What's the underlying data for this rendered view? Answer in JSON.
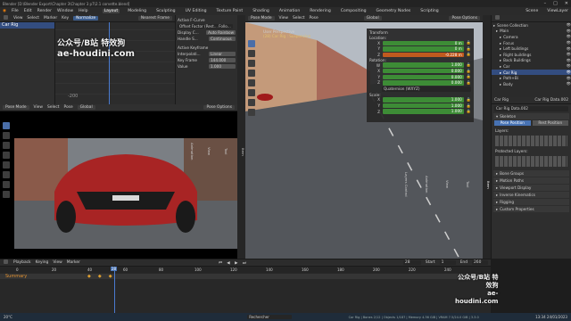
{
  "window": {
    "title": "Blender [D:\\Blender Export\\Chapter 3\\Chapter 3 p7\\2.1 corvette.blend]",
    "controls": [
      "–",
      "□",
      "✕"
    ]
  },
  "menus": [
    "File",
    "Edit",
    "Render",
    "Window",
    "Help"
  ],
  "workspaces": [
    "Layout",
    "Modeling",
    "Sculpting",
    "UV Editing",
    "Texture Paint",
    "Shading",
    "Animation",
    "Rendering",
    "Compositing",
    "Geometry Nodes",
    "Scripting"
  ],
  "active_workspace": "Layout",
  "scene": {
    "name": "Scene",
    "view_layer": "ViewLayer"
  },
  "graph": {
    "header": [
      "View",
      "Select",
      "Marker",
      "Key"
    ],
    "normalize": "Normalize",
    "pivot": "Nearest Frame",
    "label_200": "-200"
  },
  "fcurve": {
    "title": "Active F-Curve",
    "name": "Offset Factor (Rest... Follo...",
    "display_color_label": "Display C...",
    "display_color": "Auto Rainbow",
    "handle_label": "Handle S...",
    "handle": "Continuous",
    "kf_title": "Active Keyframe",
    "interp_label": "Interpolati...",
    "interp": "Linear",
    "keyframe_label": "Key Frame",
    "keyframe": "144.000",
    "value_label": "Value",
    "value": "1.000"
  },
  "left_viewport": {
    "mode": "Pose Mode",
    "menus": [
      "View",
      "Select",
      "Pose"
    ],
    "orient": "Global",
    "options": "Pose Options"
  },
  "viewport": {
    "mode": "Pose Mode",
    "menus": [
      "View",
      "Select",
      "Pose"
    ],
    "orient": "Global",
    "options": "Pose Options",
    "persp": "User Perspective",
    "sub": "(28) Car Rig : Suspension"
  },
  "side_tabs_left": [
    "Item",
    "Tool",
    "View",
    "Animation"
  ],
  "side_tabs_right": [
    "Item",
    "Tool",
    "View",
    "Animation",
    "Layers Control",
    "Tool"
  ],
  "transform": {
    "title": "Transform",
    "location": "Location:",
    "loc": [
      {
        "axis": "X",
        "v": "0 m",
        "c": "g"
      },
      {
        "axis": "Y",
        "v": "0 m",
        "c": "g"
      },
      {
        "axis": "Z",
        "v": "-0.228 m",
        "c": "o"
      }
    ],
    "rotation": "Rotation:",
    "rot": [
      {
        "axis": "W",
        "v": "1.000",
        "c": "g"
      },
      {
        "axis": "X",
        "v": "0.000",
        "c": "g"
      },
      {
        "axis": "Y",
        "v": "0.000",
        "c": "g"
      },
      {
        "axis": "Z",
        "v": "0.000",
        "c": "g"
      }
    ],
    "rot_mode": "Quaternion (WXYZ)",
    "scale": "Scale:",
    "scl": [
      {
        "axis": "X",
        "v": "1.000",
        "c": "g"
      },
      {
        "axis": "Y",
        "v": "1.000",
        "c": "g"
      },
      {
        "axis": "Z",
        "v": "1.000",
        "c": "g"
      }
    ]
  },
  "outliner": {
    "items": [
      "Scene Collection",
      "Main",
      "Camera",
      "Focus",
      "Left buildings",
      "Right buildings",
      "Back Buildings",
      "Car",
      "Car Rig",
      "Path+Bi",
      "Body"
    ]
  },
  "properties": {
    "object": "Car Rig",
    "data": "Car Rig Data.002",
    "data_field": "Car Rig Data.002",
    "skeleton": "Skeleton",
    "pose_position": "Pose Position",
    "rest_position": "Rest Position",
    "layers": "Layers:",
    "protected": "Protected Layers:",
    "sections": [
      "Bone Groups",
      "Motion Paths",
      "Viewport Display",
      "Inverse Kinematics",
      "Rigging",
      "Custom Properties"
    ]
  },
  "timeline": {
    "menus": [
      "Playback",
      "Keying",
      "View",
      "Marker"
    ],
    "frame": "28",
    "start_label": "Start",
    "start": "1",
    "end_label": "End",
    "end": "260",
    "ticks": [
      "0",
      "20",
      "40",
      "60",
      "80",
      "100",
      "120",
      "140",
      "160",
      "180",
      "200",
      "220",
      "240"
    ],
    "summary": "Summary",
    "current": "28"
  },
  "watermark": {
    "line1": "公众号/B站 特效狗",
    "line2": "ae-houdini.com"
  },
  "taskbar": {
    "weather": "20°C",
    "search": "Rechercher",
    "time": "13:34",
    "date": "24/01/2023",
    "status": "Car Rig | Bones 2/12 | Objects 1/187 | Memory 4.36 GiB | VRAM 7.5/24.0 GiB | 3.3.0"
  }
}
